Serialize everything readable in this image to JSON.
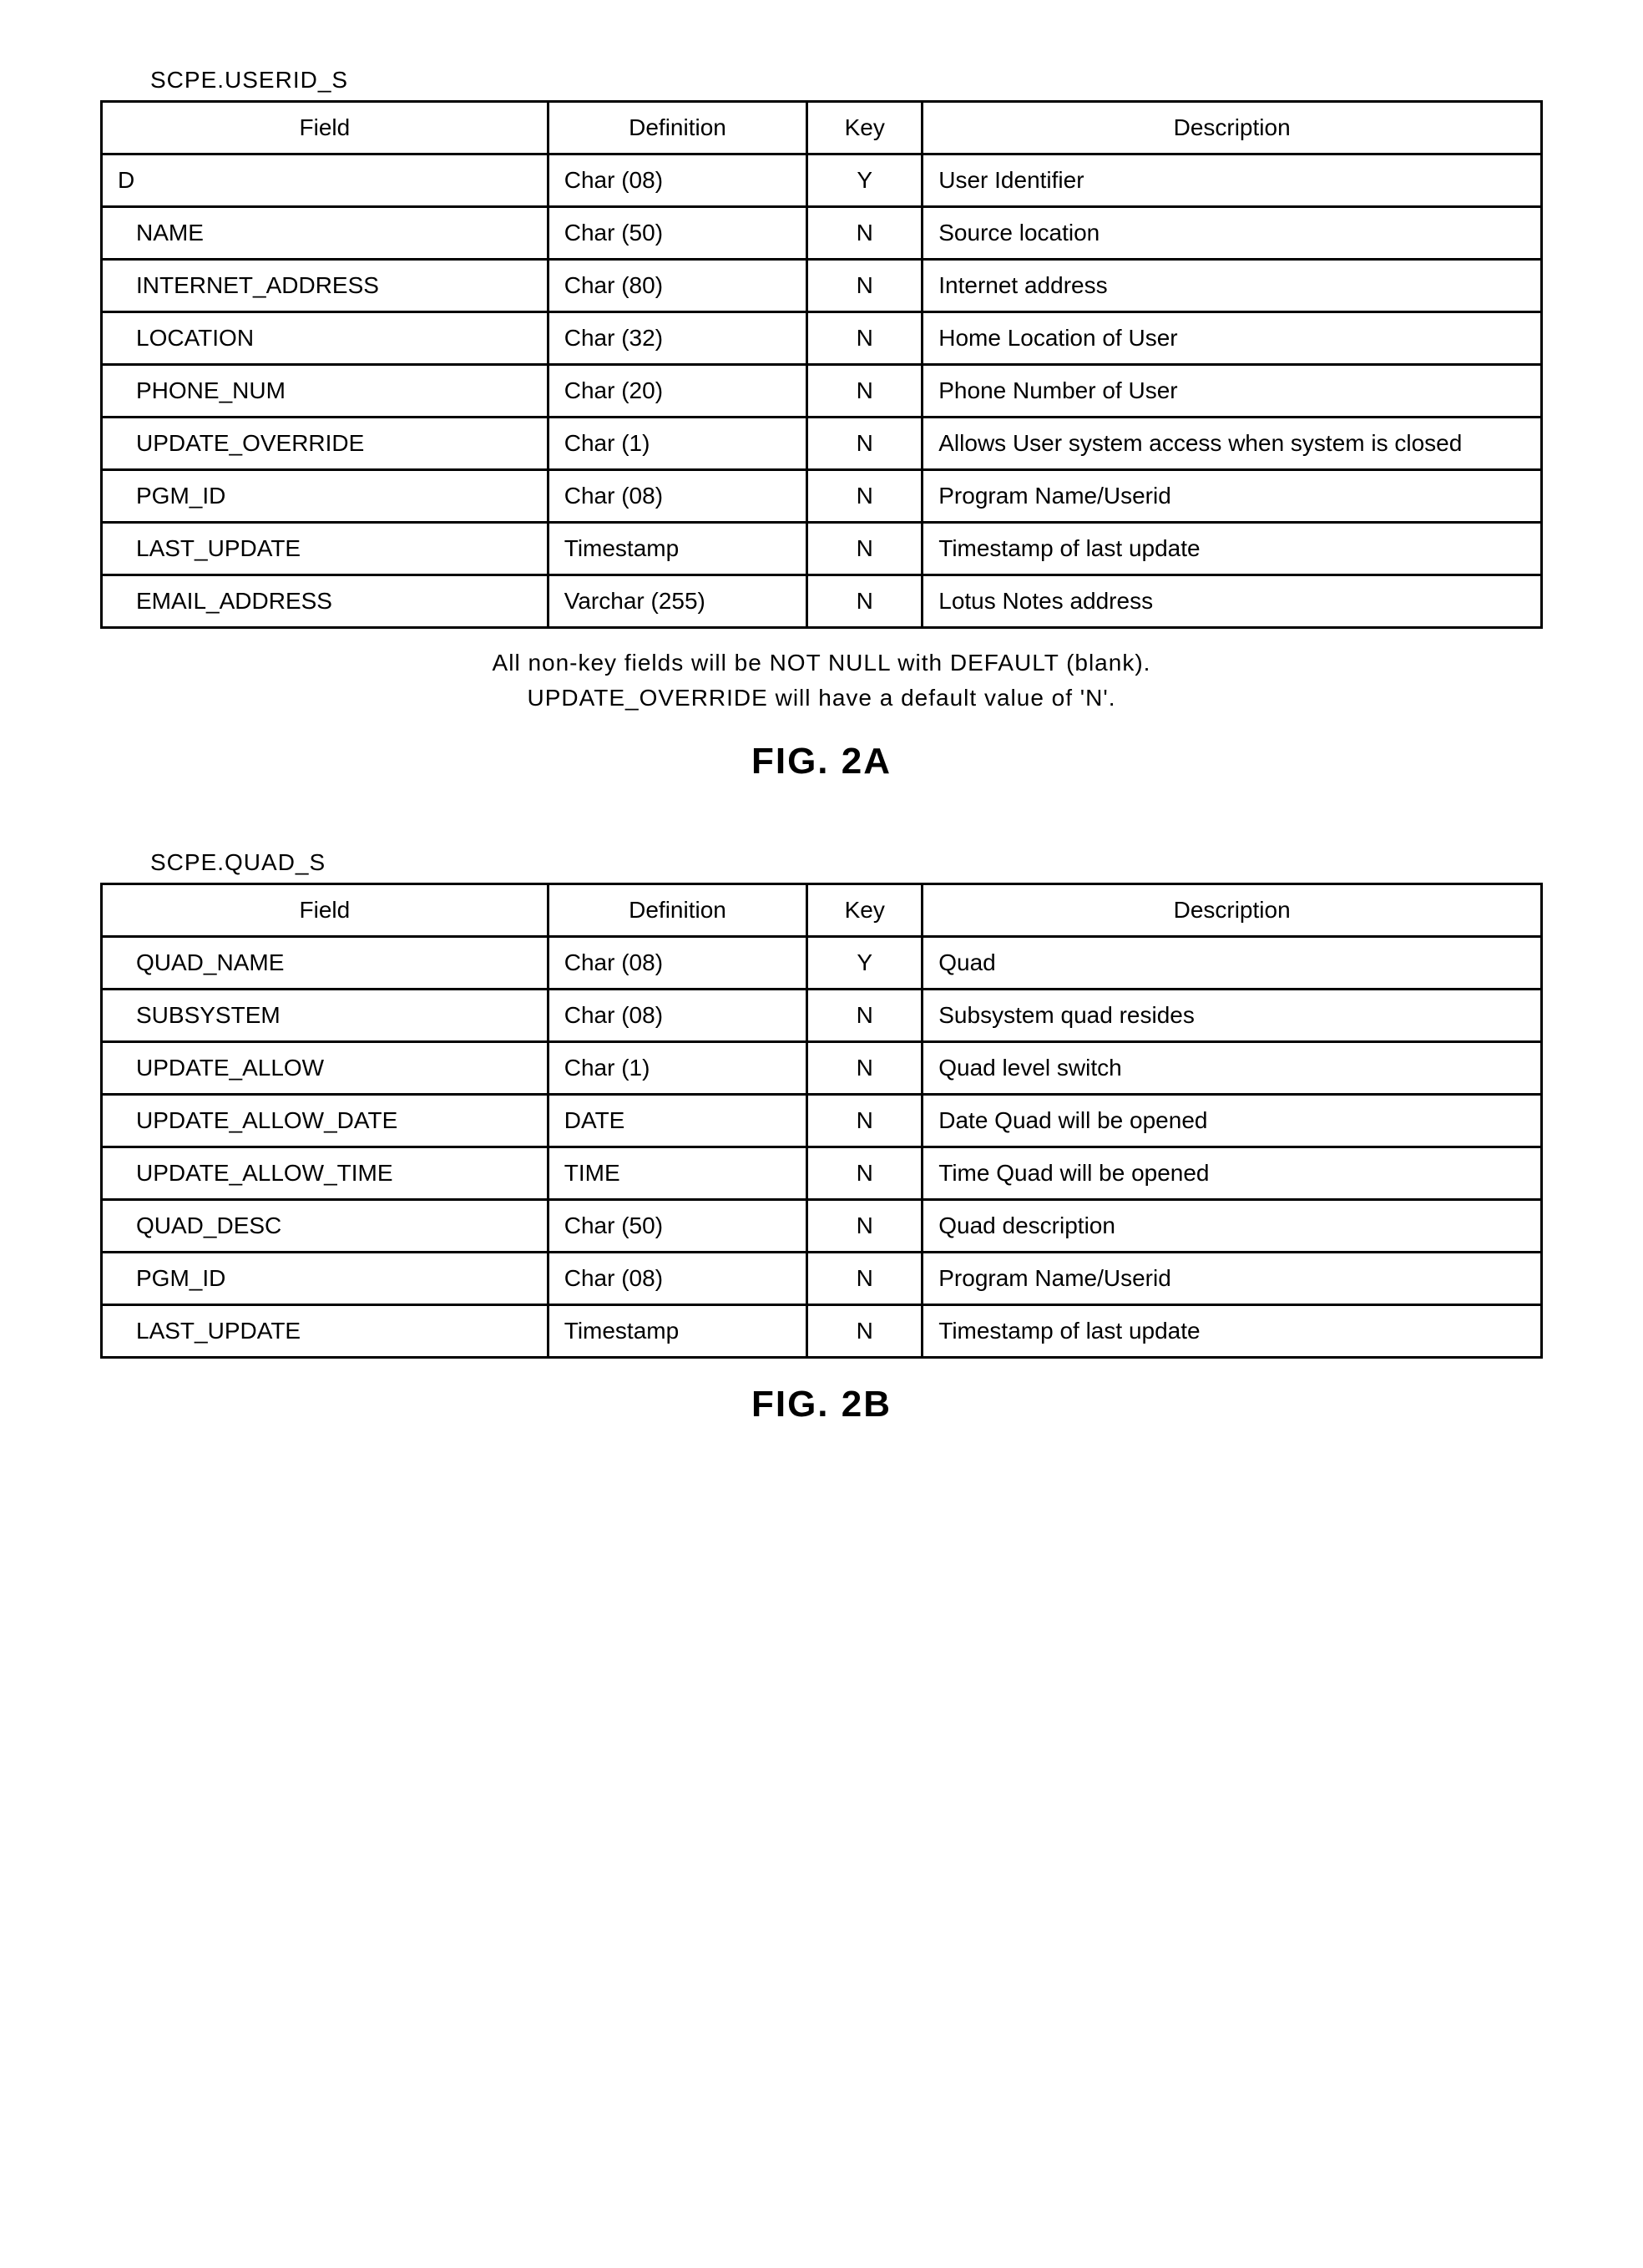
{
  "figA": {
    "tableName": "SCPE.USERID_S",
    "headers": {
      "field": "Field",
      "definition": "Definition",
      "key": "Key",
      "description": "Description"
    },
    "rows": [
      {
        "field": "D",
        "indent": 0,
        "definition": "Char (08)",
        "key": "Y",
        "description": "User Identifier"
      },
      {
        "field": "NAME",
        "indent": 1,
        "definition": "Char (50)",
        "key": "N",
        "description": "Source location"
      },
      {
        "field": "INTERNET_ADDRESS",
        "indent": 1,
        "definition": "Char (80)",
        "key": "N",
        "description": "Internet address"
      },
      {
        "field": "LOCATION",
        "indent": 1,
        "definition": "Char (32)",
        "key": "N",
        "description": "Home Location of User"
      },
      {
        "field": "PHONE_NUM",
        "indent": 1,
        "definition": "Char (20)",
        "key": "N",
        "description": "Phone Number of User"
      },
      {
        "field": "UPDATE_OVERRIDE",
        "indent": 1,
        "definition": "Char (1)",
        "key": "N",
        "description": "Allows User system access when system is closed"
      },
      {
        "field": "PGM_ID",
        "indent": 1,
        "definition": "Char (08)",
        "key": "N",
        "description": "Program Name/Userid"
      },
      {
        "field": "LAST_UPDATE",
        "indent": 1,
        "definition": "Timestamp",
        "key": "N",
        "description": "Timestamp of last update"
      },
      {
        "field": "EMAIL_ADDRESS",
        "indent": 1,
        "definition": "Varchar (255)",
        "key": "N",
        "description": "Lotus Notes address"
      }
    ],
    "footnote1": "All non-key fields will be NOT NULL with DEFAULT (blank).",
    "footnote2": "UPDATE_OVERRIDE will have a default value of 'N'.",
    "figLabel": "FIG. 2A"
  },
  "figB": {
    "tableName": "SCPE.QUAD_S",
    "headers": {
      "field": "Field",
      "definition": "Definition",
      "key": "Key",
      "description": "Description"
    },
    "rows": [
      {
        "field": "QUAD_NAME",
        "indent": 1,
        "definition": "Char (08)",
        "key": "Y",
        "description": "Quad"
      },
      {
        "field": "SUBSYSTEM",
        "indent": 1,
        "definition": "Char (08)",
        "key": "N",
        "description": "Subsystem quad resides"
      },
      {
        "field": "UPDATE_ALLOW",
        "indent": 1,
        "definition": "Char (1)",
        "key": "N",
        "description": "Quad level switch"
      },
      {
        "field": "UPDATE_ALLOW_DATE",
        "indent": 1,
        "definition": "DATE",
        "key": "N",
        "description": "Date Quad will be opened"
      },
      {
        "field": "UPDATE_ALLOW_TIME",
        "indent": 1,
        "definition": "TIME",
        "key": "N",
        "description": "Time Quad will be opened"
      },
      {
        "field": "QUAD_DESC",
        "indent": 1,
        "definition": "Char (50)",
        "key": "N",
        "description": "Quad description"
      },
      {
        "field": "PGM_ID",
        "indent": 1,
        "definition": "Char (08)",
        "key": "N",
        "description": "Program Name/Userid"
      },
      {
        "field": "LAST_UPDATE",
        "indent": 1,
        "definition": "Timestamp",
        "key": "N",
        "description": "Timestamp of last update"
      }
    ],
    "figLabel": "FIG. 2B"
  }
}
